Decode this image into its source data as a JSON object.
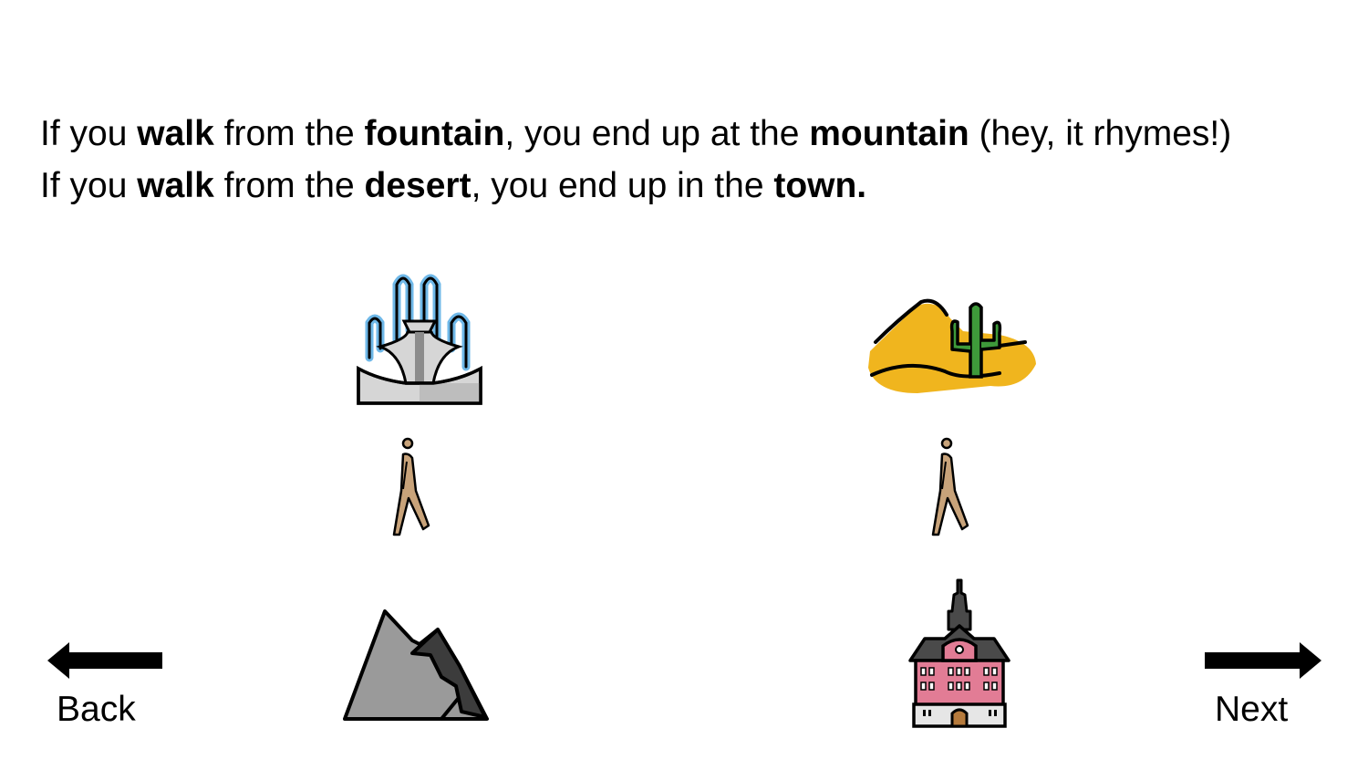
{
  "sentences": [
    {
      "parts": [
        {
          "text": "If you ",
          "bold": false
        },
        {
          "text": "walk",
          "bold": true
        },
        {
          "text": " from the ",
          "bold": false
        },
        {
          "text": "fountain",
          "bold": true
        },
        {
          "text": ", you end up at the ",
          "bold": false
        },
        {
          "text": "mountain",
          "bold": true
        },
        {
          "text": " (hey, it rhymes!)",
          "bold": false
        }
      ]
    },
    {
      "parts": [
        {
          "text": "If you ",
          "bold": false
        },
        {
          "text": "walk",
          "bold": true
        },
        {
          "text": " from the ",
          "bold": false
        },
        {
          "text": "desert",
          "bold": true
        },
        {
          "text": ", you end up in the ",
          "bold": false
        },
        {
          "text": "town.",
          "bold": true
        }
      ]
    }
  ],
  "icons": [
    "fountain-icon",
    "walking-person-icon",
    "mountain-icon",
    "desert-icon",
    "walking-person-icon",
    "town-hall-icon"
  ],
  "nav": {
    "back_label": "Back",
    "next_label": "Next"
  },
  "colors": {
    "sand": "#F0B51E",
    "cactus": "#3E9A3A",
    "skin": "#C8A37A",
    "rock": "#9A9A9A",
    "building_pink": "#E27C95",
    "water": "#6FB8E8"
  }
}
